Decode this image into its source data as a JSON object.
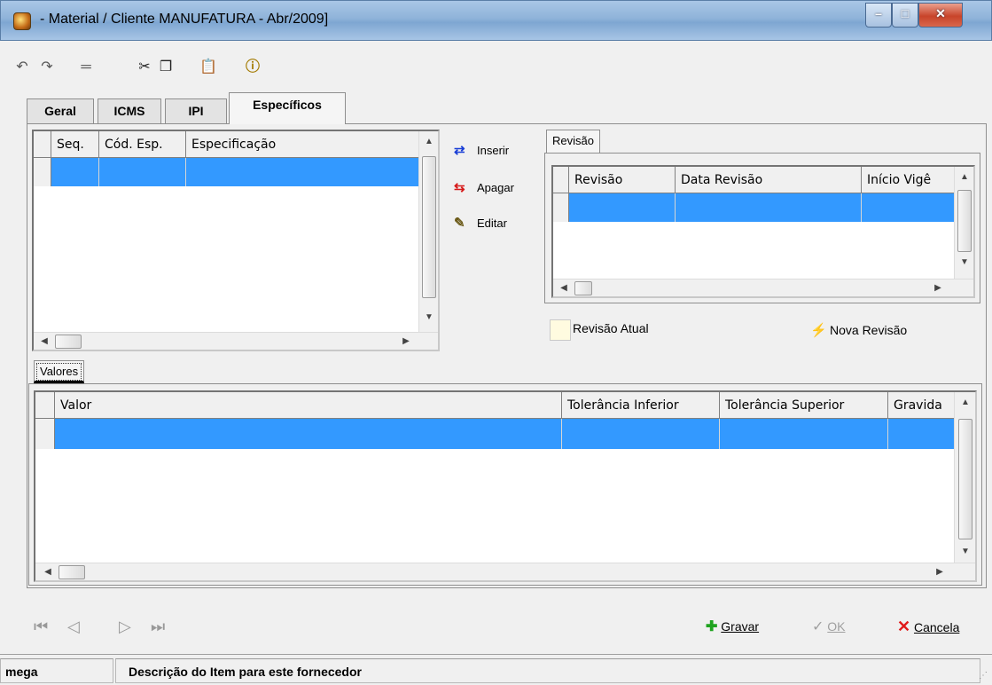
{
  "window": {
    "title": "- Material / Cliente MANUFATURA - Abr/2009]"
  },
  "toolbar": {
    "icons": [
      "undo-icon",
      "redo-icon",
      "minus-icon",
      "cut-icon",
      "copy-icon",
      "paste-icon",
      "info-icon"
    ]
  },
  "tabs": [
    {
      "label": "Geral",
      "active": false
    },
    {
      "label": "ICMS",
      "active": false
    },
    {
      "label": "IPI",
      "active": false
    },
    {
      "label": "Específicos",
      "active": true
    }
  ],
  "specs_grid": {
    "columns": [
      "Seq.",
      "Cód. Esp.",
      "Especificação"
    ]
  },
  "side_buttons": {
    "insert": "Inserir",
    "delete": "Apagar",
    "edit": "Editar"
  },
  "revision_tab": {
    "label": "Revisão",
    "columns": [
      "Revisão",
      "Data Revisão",
      "Início Vigê"
    ]
  },
  "revision_controls": {
    "current": "Revisão Atual",
    "new": "Nova Revisão"
  },
  "values_tab": {
    "label": "Valores",
    "columns": [
      "Valor",
      "Tolerância Inferior",
      "Tolerância Superior",
      "Gravida"
    ]
  },
  "actions": {
    "save": "Gravar",
    "ok": "OK",
    "cancel": "Cancela"
  },
  "status": {
    "left": "mega",
    "right": "Descrição do Item para este fornecedor"
  },
  "colors": {
    "selection": "#3399ff",
    "titlebar": "#9dbde0",
    "close": "#c8442a"
  }
}
